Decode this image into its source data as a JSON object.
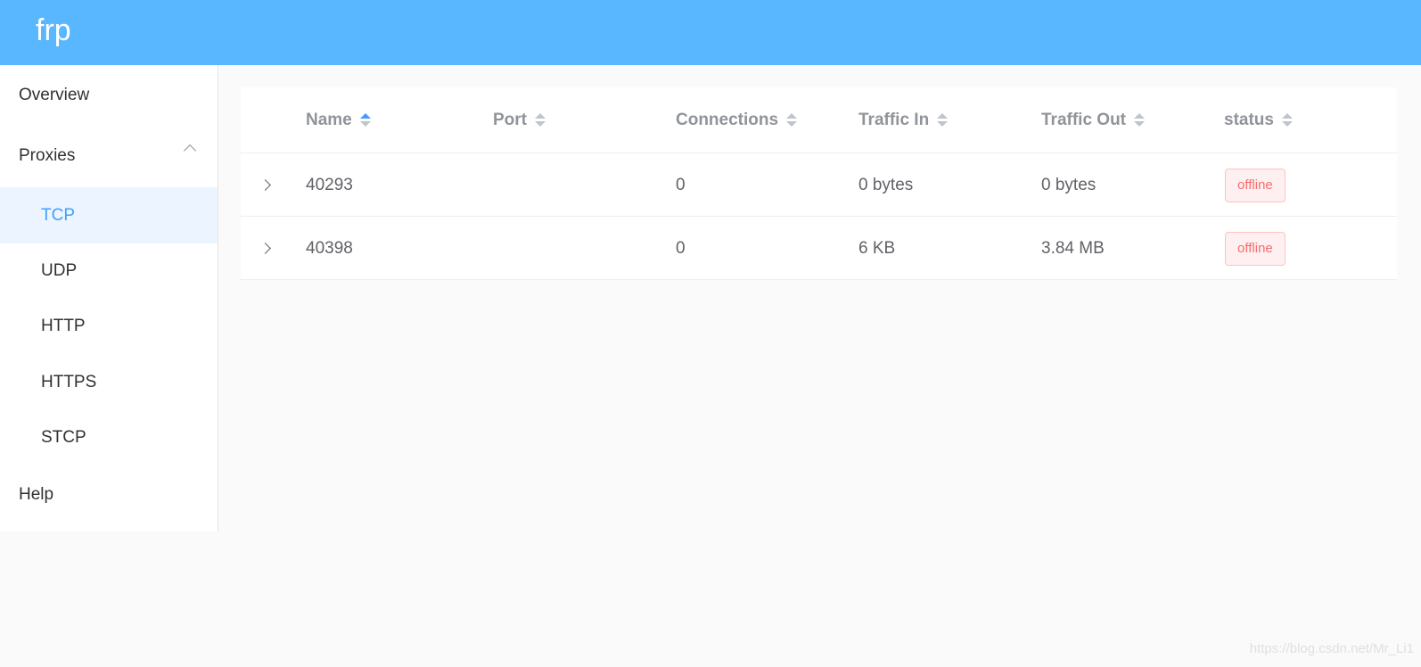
{
  "header": {
    "brand": "frp",
    "color": "#58b7ff"
  },
  "sidebar": {
    "overview": "Overview",
    "proxies": {
      "label": "Proxies",
      "expanded": true,
      "items": [
        "TCP",
        "UDP",
        "HTTP",
        "HTTPS",
        "STCP"
      ],
      "active": "TCP"
    },
    "help": "Help"
  },
  "table": {
    "columns": [
      "Name",
      "Port",
      "Connections",
      "Traffic In",
      "Traffic Out",
      "status"
    ],
    "sort": {
      "column": "Name",
      "order": "ascending"
    },
    "rows": [
      {
        "name": "40293",
        "port": "",
        "connections": "0",
        "traffic_in": "0 bytes",
        "traffic_out": "0 bytes",
        "status": "offline"
      },
      {
        "name": "40398",
        "port": "",
        "connections": "0",
        "traffic_in": "6 KB",
        "traffic_out": "3.84 MB",
        "status": "offline"
      }
    ]
  },
  "watermark": "https://blog.csdn.net/Mr_Li1"
}
